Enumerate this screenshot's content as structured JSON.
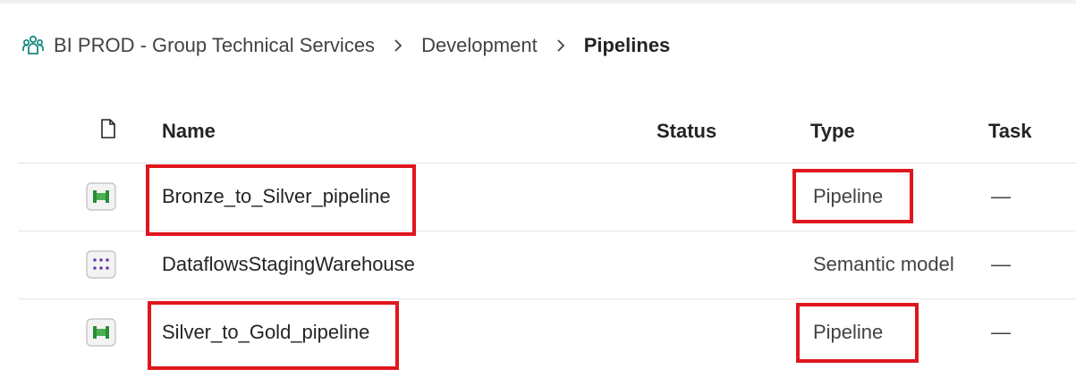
{
  "breadcrumb": {
    "workspace_icon": "workspace-people-icon",
    "items": [
      "BI PROD - Group Technical Services",
      "Development",
      "Pipelines"
    ],
    "separator_icon": "chevron-right-icon"
  },
  "table": {
    "header_icon": "document-icon",
    "columns": [
      "Name",
      "Status",
      "Type",
      "Task"
    ],
    "rows": [
      {
        "icon": "pipeline-icon",
        "name": "Bronze_to_Silver_pipeline",
        "status": "",
        "type": "Pipeline",
        "task": "—",
        "highlighted": true
      },
      {
        "icon": "semantic-model-icon",
        "name": "DataflowsStagingWarehouse",
        "status": "",
        "type": "Semantic model",
        "task": "—",
        "highlighted": false
      },
      {
        "icon": "pipeline-icon",
        "name": "Silver_to_Gold_pipeline",
        "status": "",
        "type": "Pipeline",
        "task": "—",
        "highlighted": true
      }
    ]
  },
  "colors": {
    "highlight": "#e0161d",
    "pipeline_green": "#2e8b3a",
    "semantic_purple": "#6b3fb0",
    "workspace_teal": "#1a8a82"
  }
}
